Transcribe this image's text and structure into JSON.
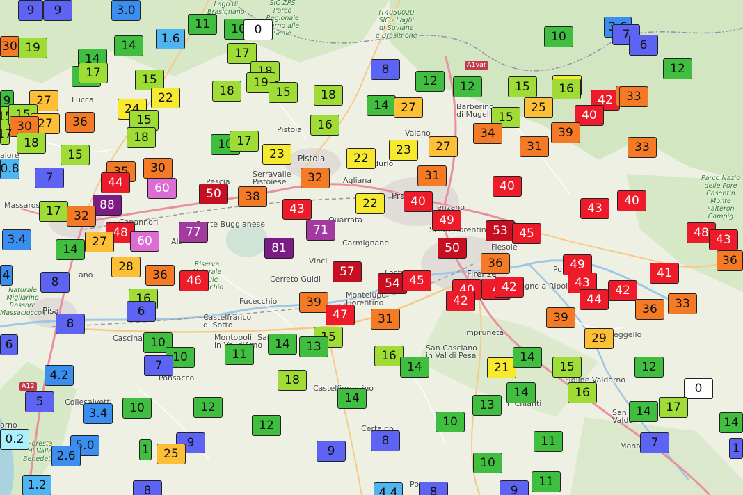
{
  "colors": {
    "lt1": "#aaf0ff",
    "c1": "#4fb5f2",
    "c3": "#3a8ef0",
    "c5": "#5d63f2",
    "c9": "#4a4cf0",
    "c15": "#3fbe3f",
    "c19": "#9fdc36",
    "c24": "#f7ea2e",
    "c29": "#fcbf36",
    "c35": "#f47a26",
    "c45": "#ee1c2a",
    "c60": "#c80f22",
    "c75": "#dc6ed3",
    "c90": "#a33aa0",
    "c100": "#7d1b86",
    "zero": "#ffffff"
  },
  "places": [
    {
      "id": "lago-brasignano",
      "text": "Lago di\nBrasignano",
      "style": "green"
    },
    {
      "id": "sic-zps",
      "text": "SIC-ZPS\nParco\nRegionale\nCorno alle\nScale",
      "style": "green"
    },
    {
      "id": "it4050020",
      "text": "IT4050020\nSIC - Laghi\ndi Suviana\ne Brasimone",
      "style": "green"
    },
    {
      "id": "a1var",
      "text": "A1var",
      "style": "road"
    },
    {
      "id": "lucca",
      "text": "Lucca",
      "style": ""
    },
    {
      "id": "barberino",
      "text": "Barberino\ndi Mugello",
      "style": ""
    },
    {
      "id": "vaiano",
      "text": "Vaiano",
      "style": ""
    },
    {
      "id": "pistoia-small",
      "text": "Pistoia",
      "style": ""
    },
    {
      "id": "pistoia",
      "text": "Pistoia",
      "style": "big"
    },
    {
      "id": "aiore",
      "text": "aiore",
      "style": ""
    },
    {
      "id": "pescia",
      "text": "Pescia",
      "style": ""
    },
    {
      "id": "serravalle",
      "text": "Serravalle\nPistoiese",
      "style": ""
    },
    {
      "id": "agliana",
      "text": "Agliana",
      "style": ""
    },
    {
      "id": "durlo",
      "text": "durlo",
      "style": ""
    },
    {
      "id": "prato",
      "text": "Prato",
      "style": "big"
    },
    {
      "id": "massarosa",
      "text": "Massarosa",
      "style": ""
    },
    {
      "id": "capannori",
      "text": "Capannori",
      "style": ""
    },
    {
      "id": "parco-foreste",
      "text": "Parco Nazio\ndelle Fore\nCasentin\nMonte\nFalteron\nCampig",
      "style": "green"
    },
    {
      "id": "enzano",
      "text": "enzano",
      "style": ""
    },
    {
      "id": "sesto",
      "text": "Sesto Fiorentino",
      "style": ""
    },
    {
      "id": "buggianese",
      "text": "Ponte Buggianese",
      "style": ""
    },
    {
      "id": "quarrata",
      "text": "Quarrata",
      "style": ""
    },
    {
      "id": "carmignano",
      "text": "Carmignano",
      "style": ""
    },
    {
      "id": "fiesole",
      "text": "Fiesole",
      "style": ""
    },
    {
      "id": "lano",
      "text": "ano",
      "style": ""
    },
    {
      "id": "riserva",
      "text": "Riserva\nNaturale\nPadule\nFucecchio",
      "style": "green"
    },
    {
      "id": "vinci",
      "text": "Vinci",
      "style": ""
    },
    {
      "id": "altopascio",
      "text": "Alt",
      "style": ""
    },
    {
      "id": "lastra",
      "text": "Lastra",
      "style": ""
    },
    {
      "id": "firenze",
      "text": "Firenze",
      "style": "big"
    },
    {
      "id": "pont",
      "text": "Pon",
      "style": ""
    },
    {
      "id": "naturale-rossore",
      "text": "Naturale\nMigliarino\nRossore\nMassaciuccoli",
      "style": "green"
    },
    {
      "id": "pisa",
      "text": "Pisa",
      "style": "big"
    },
    {
      "id": "cerreto",
      "text": "Cerreto Guidi",
      "style": ""
    },
    {
      "id": "fucecchio",
      "text": "Fucecchio",
      "style": ""
    },
    {
      "id": "montelupo",
      "text": "Montelupo\nFiorentino",
      "style": ""
    },
    {
      "id": "bagno-ripoli",
      "text": "Bagno a Ripoli",
      "style": ""
    },
    {
      "id": "castelfranco",
      "text": "Castelfranco\ndi Sotto",
      "style": ""
    },
    {
      "id": "impruneta",
      "text": "Impruneta",
      "style": ""
    },
    {
      "id": "cascina",
      "text": "Cascina",
      "style": ""
    },
    {
      "id": "montopoli",
      "text": "Montopoli\nin Val d'Arno",
      "style": ""
    },
    {
      "id": "reggello",
      "text": "eggello",
      "style": ""
    },
    {
      "id": "sanmin",
      "text": "San",
      "style": ""
    },
    {
      "id": "casciano",
      "text": "San Casciano\nin Val di Pesa",
      "style": ""
    },
    {
      "id": "ponsacco",
      "text": "Ponsacco",
      "style": ""
    },
    {
      "id": "figline",
      "text": "Figline Valdarno",
      "style": ""
    },
    {
      "id": "a12",
      "text": "A12",
      "style": "road"
    },
    {
      "id": "castelfiorentino",
      "text": "Castelfiorentino",
      "style": ""
    },
    {
      "id": "collesalvetti",
      "text": "Collesalvetti",
      "style": ""
    },
    {
      "id": "chianti",
      "text": "in Chianti",
      "style": ""
    },
    {
      "id": "sangiov",
      "text": "San Giov\nValdar",
      "style": ""
    },
    {
      "id": "orno",
      "text": "orno",
      "style": ""
    },
    {
      "id": "foresta",
      "text": "Foresta\ndi Valle\nBenedetta",
      "style": "green"
    },
    {
      "id": "certaldo",
      "text": "Certaldo",
      "style": ""
    },
    {
      "id": "monte",
      "text": "Monte",
      "style": ""
    },
    {
      "id": "pog",
      "text": "Po",
      "style": ""
    }
  ],
  "markers": [
    {
      "v": "9",
      "c": "c5",
      "w": 0
    },
    {
      "v": "9",
      "c": "c5",
      "w": 0
    },
    {
      "v": "3.0",
      "c": "c3",
      "w": 0
    },
    {
      "v": "11",
      "c": "c15",
      "w": 0
    },
    {
      "v": "10",
      "c": "c15",
      "w": 0
    },
    {
      "v": "0",
      "c": "zero",
      "w": 0
    },
    {
      "v": "3.6",
      "c": "c3",
      "w": 0
    },
    {
      "v": "7",
      "c": "c5",
      "w": 0
    },
    {
      "v": "6",
      "c": "c5",
      "w": 0
    },
    {
      "v": "30",
      "c": "c35",
      "w": 0
    },
    {
      "v": "19",
      "c": "c19",
      "w": 0
    },
    {
      "v": "14",
      "c": "c15",
      "w": 0
    },
    {
      "v": "1.6",
      "c": "c1",
      "w": 0
    },
    {
      "v": "17",
      "c": "c19",
      "w": 0
    },
    {
      "v": "10",
      "c": "c15",
      "w": 0
    },
    {
      "v": "14",
      "c": "c15",
      "w": 0
    },
    {
      "v": "14",
      "c": "c15",
      "w": 0
    },
    {
      "v": "18",
      "c": "c19",
      "w": 0
    },
    {
      "v": "8",
      "c": "c5",
      "w": 0
    },
    {
      "v": "17",
      "c": "c19",
      "w": 0
    },
    {
      "v": "12",
      "c": "c15",
      "w": 0
    },
    {
      "v": "15",
      "c": "c19",
      "w": 0
    },
    {
      "v": "19",
      "c": "c19",
      "w": 0
    },
    {
      "v": "15",
      "c": "c19",
      "w": 0
    },
    {
      "v": "12",
      "c": "c15",
      "w": 0
    },
    {
      "v": "12",
      "c": "c15",
      "w": 0
    },
    {
      "v": "15",
      "c": "c19",
      "w": 0
    },
    {
      "v": "20",
      "c": "c24",
      "w": 0
    },
    {
      "v": "22",
      "c": "c24",
      "w": 0
    },
    {
      "v": "18",
      "c": "c19",
      "w": 0
    },
    {
      "v": "16",
      "c": "c19",
      "w": 0
    },
    {
      "v": "18",
      "c": "c19",
      "w": 0
    },
    {
      "v": "27",
      "c": "c29",
      "w": 0
    },
    {
      "v": "9",
      "c": "c15",
      "w": 0
    },
    {
      "v": "15",
      "c": "c19",
      "w": 0
    },
    {
      "v": "14",
      "c": "c15",
      "w": 0
    },
    {
      "v": "15",
      "c": "c19",
      "w": 0
    },
    {
      "v": "24",
      "c": "c24",
      "w": 0
    },
    {
      "v": "27",
      "c": "c29",
      "w": 0
    },
    {
      "v": "25",
      "c": "c29",
      "w": 0
    },
    {
      "v": "42",
      "c": "c45",
      "w": 1
    },
    {
      "v": "35",
      "c": "c35",
      "w": 0
    },
    {
      "v": "40",
      "c": "c45",
      "w": 1
    },
    {
      "v": "27",
      "c": "c29",
      "w": 0
    },
    {
      "v": "36",
      "c": "c35",
      "w": 0
    },
    {
      "v": "15",
      "c": "c19",
      "w": 0
    },
    {
      "v": "15",
      "c": "c19",
      "w": 0
    },
    {
      "v": "16",
      "c": "c19",
      "w": 0
    },
    {
      "v": "33",
      "c": "c35",
      "w": 0
    },
    {
      "v": "30",
      "c": "c35",
      "w": 0
    },
    {
      "v": "18",
      "c": "c19",
      "w": 0
    },
    {
      "v": "17",
      "c": "c19",
      "w": 0
    },
    {
      "v": "10",
      "c": "c15",
      "w": 0
    },
    {
      "v": "17",
      "c": "c19",
      "w": 0
    },
    {
      "v": "18",
      "c": "c19",
      "w": 0
    },
    {
      "v": "31",
      "c": "c35",
      "w": 0
    },
    {
      "v": "39",
      "c": "c35",
      "w": 0
    },
    {
      "v": "33",
      "c": "c35",
      "w": 0
    },
    {
      "v": "15",
      "c": "c19",
      "w": 0
    },
    {
      "v": "23",
      "c": "c24",
      "w": 0
    },
    {
      "v": "22",
      "c": "c24",
      "w": 0
    },
    {
      "v": "23",
      "c": "c24",
      "w": 0
    },
    {
      "v": "27",
      "c": "c29",
      "w": 0
    },
    {
      "v": "34",
      "c": "c35",
      "w": 0
    },
    {
      "v": "0.8",
      "c": "c1",
      "w": 0
    },
    {
      "v": "35",
      "c": "c35",
      "w": 0
    },
    {
      "v": "30",
      "c": "c35",
      "w": 0
    },
    {
      "v": "7",
      "c": "c5",
      "w": 0
    },
    {
      "v": "44",
      "c": "c45",
      "w": 1
    },
    {
      "v": "32",
      "c": "c35",
      "w": 0
    },
    {
      "v": "31",
      "c": "c35",
      "w": 0
    },
    {
      "v": "40",
      "c": "c45",
      "w": 1
    },
    {
      "v": "60",
      "c": "c75",
      "w": 1
    },
    {
      "v": "50",
      "c": "c60",
      "w": 1
    },
    {
      "v": "38",
      "c": "c35",
      "w": 0
    },
    {
      "v": "22",
      "c": "c24",
      "w": 0
    },
    {
      "v": "40",
      "c": "c45",
      "w": 1
    },
    {
      "v": "43",
      "c": "c45",
      "w": 1
    },
    {
      "v": "40",
      "c": "c45",
      "w": 1
    },
    {
      "v": "88",
      "c": "c100",
      "w": 1
    },
    {
      "v": "17",
      "c": "c19",
      "w": 0
    },
    {
      "v": "32",
      "c": "c35",
      "w": 0
    },
    {
      "v": "43",
      "c": "c45",
      "w": 1
    },
    {
      "v": "49",
      "c": "c45",
      "w": 1
    },
    {
      "v": "48",
      "c": "c45",
      "w": 1
    },
    {
      "v": "77",
      "c": "c90",
      "w": 1
    },
    {
      "v": "71",
      "c": "c90",
      "w": 1
    },
    {
      "v": "53",
      "c": "c60",
      "w": 1
    },
    {
      "v": "45",
      "c": "c45",
      "w": 1
    },
    {
      "v": "48",
      "c": "c45",
      "w": 1
    },
    {
      "v": "3.4",
      "c": "c3",
      "w": 0
    },
    {
      "v": "27",
      "c": "c29",
      "w": 0
    },
    {
      "v": "60",
      "c": "c75",
      "w": 1
    },
    {
      "v": "43",
      "c": "c45",
      "w": 1
    },
    {
      "v": "14",
      "c": "c15",
      "w": 0
    },
    {
      "v": "81",
      "c": "c100",
      "w": 1
    },
    {
      "v": "50",
      "c": "c60",
      "w": 1
    },
    {
      "v": "36",
      "c": "c35",
      "w": 0
    },
    {
      "v": "28",
      "c": "c29",
      "w": 0
    },
    {
      "v": "57",
      "c": "c60",
      "w": 1
    },
    {
      "v": "49",
      "c": "c45",
      "w": 1
    },
    {
      "v": "41",
      "c": "c45",
      "w": 1
    },
    {
      "v": "4",
      "c": "c3",
      "w": 0
    },
    {
      "v": "8",
      "c": "c5",
      "w": 0
    },
    {
      "v": "36",
      "c": "c35",
      "w": 0
    },
    {
      "v": "46",
      "c": "c45",
      "w": 1
    },
    {
      "v": "54",
      "c": "c60",
      "w": 1
    },
    {
      "v": "45",
      "c": "c45",
      "w": 1
    },
    {
      "v": "43",
      "c": "c45",
      "w": 1
    },
    {
      "v": "40",
      "c": "c45",
      "w": 1
    },
    {
      "v": "4",
      "c": "c45",
      "w": 1
    },
    {
      "v": "42",
      "c": "c45",
      "w": 1
    },
    {
      "v": "16",
      "c": "c19",
      "w": 0
    },
    {
      "v": "42",
      "c": "c45",
      "w": 1
    },
    {
      "v": "6",
      "c": "c5",
      "w": 0
    },
    {
      "v": "39",
      "c": "c35",
      "w": 0
    },
    {
      "v": "42",
      "c": "c45",
      "w": 1
    },
    {
      "v": "44",
      "c": "c45",
      "w": 1
    },
    {
      "v": "36",
      "c": "c35",
      "w": 0
    },
    {
      "v": "33",
      "c": "c35",
      "w": 0
    },
    {
      "v": "47",
      "c": "c45",
      "w": 1
    },
    {
      "v": "31",
      "c": "c35",
      "w": 0
    },
    {
      "v": "39",
      "c": "c35",
      "w": 0
    },
    {
      "v": "8",
      "c": "c5",
      "w": 0
    },
    {
      "v": "15",
      "c": "c19",
      "w": 0
    },
    {
      "v": "29",
      "c": "c29",
      "w": 0
    },
    {
      "v": "6",
      "c": "c5",
      "w": 0
    },
    {
      "v": "10",
      "c": "c15",
      "w": 0
    },
    {
      "v": "14",
      "c": "c15",
      "w": 0
    },
    {
      "v": "13",
      "c": "c15",
      "w": 0
    },
    {
      "v": "10",
      "c": "c15",
      "w": 0
    },
    {
      "v": "11",
      "c": "c15",
      "w": 0
    },
    {
      "v": "16",
      "c": "c19",
      "w": 0
    },
    {
      "v": "14",
      "c": "c15",
      "w": 0
    },
    {
      "v": "21",
      "c": "c24",
      "w": 0
    },
    {
      "v": "14",
      "c": "c15",
      "w": 0
    },
    {
      "v": "15",
      "c": "c19",
      "w": 0
    },
    {
      "v": "12",
      "c": "c15",
      "w": 0
    },
    {
      "v": "7",
      "c": "c5",
      "w": 0
    },
    {
      "v": "4.2",
      "c": "c3",
      "w": 0
    },
    {
      "v": "18",
      "c": "c19",
      "w": 0
    },
    {
      "v": "0",
      "c": "zero",
      "w": 0
    },
    {
      "v": "16",
      "c": "c19",
      "w": 0
    },
    {
      "v": "5",
      "c": "c5",
      "w": 0
    },
    {
      "v": "10",
      "c": "c15",
      "w": 0
    },
    {
      "v": "12",
      "c": "c15",
      "w": 0
    },
    {
      "v": "14",
      "c": "c15",
      "w": 0
    },
    {
      "v": "14",
      "c": "c15",
      "w": 0
    },
    {
      "v": "13",
      "c": "c15",
      "w": 0
    },
    {
      "v": "14",
      "c": "c15",
      "w": 0
    },
    {
      "v": "17",
      "c": "c19",
      "w": 0
    },
    {
      "v": "3.4",
      "c": "c3",
      "w": 0
    },
    {
      "v": "12",
      "c": "c15",
      "w": 0
    },
    {
      "v": "10",
      "c": "c15",
      "w": 0
    },
    {
      "v": "0.2",
      "c": "lt1",
      "w": 0
    },
    {
      "v": "5.0",
      "c": "c3",
      "w": 0
    },
    {
      "v": "8",
      "c": "c5",
      "w": 0
    },
    {
      "v": "11",
      "c": "c15",
      "w": 0
    },
    {
      "v": "14",
      "c": "c15",
      "w": 0
    },
    {
      "v": "2.6",
      "c": "c3",
      "w": 0
    },
    {
      "v": "9",
      "c": "c5",
      "w": 0
    },
    {
      "v": "1",
      "c": "c15",
      "w": 0
    },
    {
      "v": "25",
      "c": "c29",
      "w": 0
    },
    {
      "v": "9",
      "c": "c5",
      "w": 0
    },
    {
      "v": "7",
      "c": "c5",
      "w": 0
    },
    {
      "v": "10",
      "c": "c15",
      "w": 0
    },
    {
      "v": "1.2",
      "c": "c1",
      "w": 0
    },
    {
      "v": "8",
      "c": "c5",
      "w": 0
    },
    {
      "v": "4.4",
      "c": "c1",
      "w": 0
    },
    {
      "v": "8",
      "c": "c5",
      "w": 0
    },
    {
      "v": "9",
      "c": "c5",
      "w": 0
    },
    {
      "v": "11",
      "c": "c15",
      "w": 0
    },
    {
      "v": "6",
      "c": "c5",
      "w": 0
    },
    {
      "v": "1",
      "c": "c5",
      "w": 0
    },
    {
      "v": "14",
      "c": "c15",
      "w": 0
    },
    {
      "v": "36",
      "c": "c35",
      "w": 0
    }
  ]
}
